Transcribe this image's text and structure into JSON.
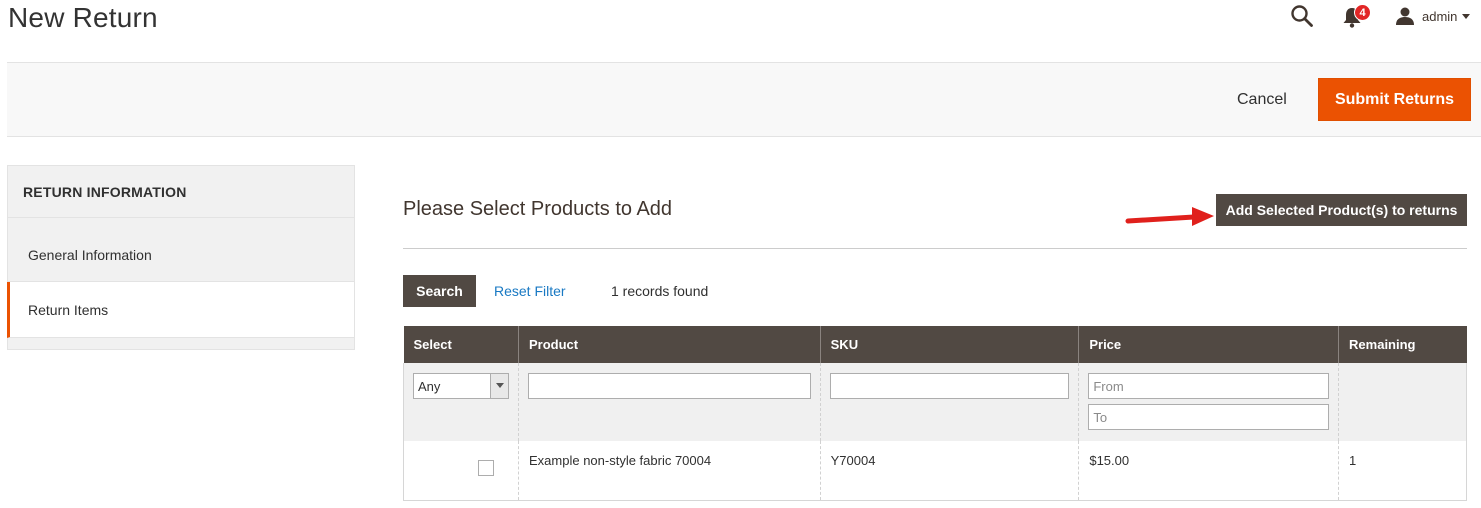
{
  "header": {
    "title": "New Return",
    "notification_count": "4",
    "user_name": "admin"
  },
  "actions": {
    "cancel_label": "Cancel",
    "submit_label": "Submit Returns"
  },
  "sidebar": {
    "heading": "RETURN INFORMATION",
    "items": [
      {
        "label": "General Information",
        "active": false
      },
      {
        "label": "Return Items",
        "active": true
      }
    ]
  },
  "main": {
    "section_title": "Please Select Products to Add",
    "add_button_label": "Add Selected Product(s) to returns",
    "search_button_label": "Search",
    "reset_filter_label": "Reset Filter",
    "records_found": "1 records found"
  },
  "grid": {
    "columns": [
      "Select",
      "Product",
      "SKU",
      "Price",
      "Remaining"
    ],
    "filters": {
      "select_value": "Any",
      "product_value": "",
      "sku_value": "",
      "price_from_placeholder": "From",
      "price_to_placeholder": "To"
    },
    "rows": [
      {
        "selected": false,
        "product": "Example non-style fabric 70004",
        "sku": "Y70004",
        "price": "$15.00",
        "remaining": "1"
      }
    ]
  },
  "colors": {
    "accent": "#eb5202",
    "dark_button": "#514943",
    "link": "#1979c3",
    "badge": "#e22626",
    "annotation_arrow": "#e0201c"
  }
}
